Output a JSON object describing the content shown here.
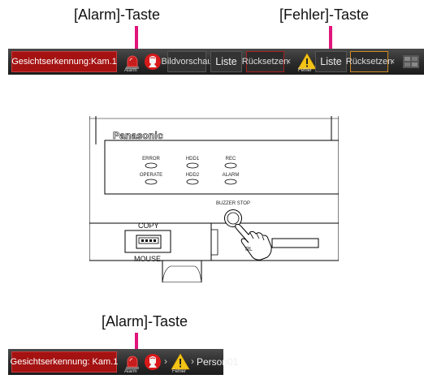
{
  "callouts": {
    "alarm_top": "[Alarm]-Taste",
    "error_top": "[Fehler]-Taste",
    "alarm_bottom": "[Alarm]-Taste"
  },
  "bar_top": {
    "face_label": "Gesichtserkennung:Kam.1",
    "alarm_caption": "Alarm",
    "preview_label": "Bildvorschau",
    "list_label_1": "Liste",
    "reset_label_1": "Rücksetzen",
    "error_caption": "Fehler",
    "list_label_2": "Liste",
    "reset_label_2": "Rücksetzen",
    "chevron": "‹"
  },
  "device": {
    "brand": "Panasonic",
    "led_labels": [
      "ERROR",
      "HDD1",
      "REC",
      "OPERATE",
      "HDD2",
      "ALARM"
    ],
    "buzzer_label": "BUZZER STOP",
    "copy_label": "COPY",
    "mouse_label": "MOUSE",
    "partial_label": "RL"
  },
  "bar_bottom": {
    "face_label": "Gesichtserkennung: Kam.1",
    "alarm_caption": "Alarm",
    "error_caption": "Fehler",
    "person_label": "Person01",
    "chevron": "›"
  },
  "colors": {
    "callout_pin": "#e0147a",
    "alarm_red": "#a51212",
    "reset_border_red": "#a82020",
    "reset_border_orange": "#d08a22",
    "warning_yellow": "#f3c316"
  }
}
